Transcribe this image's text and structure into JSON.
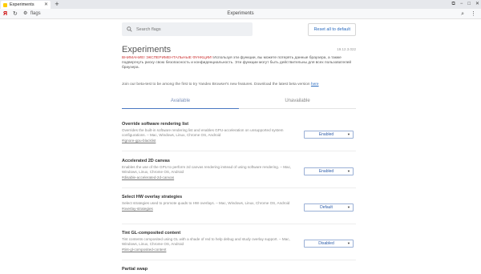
{
  "browser": {
    "tab_title": "Experiments",
    "tab_close": "✕",
    "new_tab": "+",
    "window_controls": [
      "⧉",
      "−",
      "□",
      "✕"
    ],
    "toolbar": {
      "logo": "Я",
      "reload": "↻",
      "site_icon": "⚙",
      "crumb": "flags",
      "title": "Experiments",
      "search_icon": "⌕",
      "menu_icon": "⋮"
    }
  },
  "page": {
    "search_placeholder": "Search flags",
    "reset_button": "Reset all to default",
    "title": "Experiments",
    "version": "19.12.3.022",
    "warning_red": "ВНИМАНИЕ! ЭКСПЕРИМЕНТАЛЬНЫЕ ФУНКЦИИ!",
    "warning_text": " Используя эти функции, вы можете потерять данные браузера, а также подвергнуть риску свою безопасность и конфиденциальность. Эти функции могут быть действительны для всех пользователей браузера.",
    "join_text": "Join our beta-test to be among the first to try Yandex Browser's new features. Download the latest beta version ",
    "join_link": "here",
    "tabs": [
      "Available",
      "Unavailable"
    ]
  },
  "experiments": [
    {
      "name": "Override software rendering list",
      "desc": "Overrides the built-in software rendering list and enables GPU-acceleration on unsupported system configurations. – Mac, Windows, Linux, Chrome OS, Android",
      "link": "#ignore-gpu-blacklist",
      "value": "Enabled"
    },
    {
      "name": "Accelerated 2D canvas",
      "desc": "Enables the use of the GPU to perform 2d canvas rendering instead of using software rendering. – Mac, Windows, Linux, Chrome OS, Android",
      "link": "#disable-accelerated-2d-canvas",
      "value": "Enabled"
    },
    {
      "name": "Select HW overlay strategies",
      "desc": "Select strategies used to promote quads to HW overlays. – Mac, Windows, Linux, Chrome OS, Android",
      "link": "#overlay-strategies",
      "value": "Default"
    },
    {
      "name": "Tint GL-composited content",
      "desc": "Tint contents composited using GL with a shade of red to help debug and study overlay support. – Mac, Windows, Linux, Chrome OS, Android",
      "link": "#tint-gl-composited-content",
      "value": "Disabled"
    },
    {
      "name": "Partial swap",
      "desc": "",
      "link": "",
      "value": ""
    }
  ]
}
